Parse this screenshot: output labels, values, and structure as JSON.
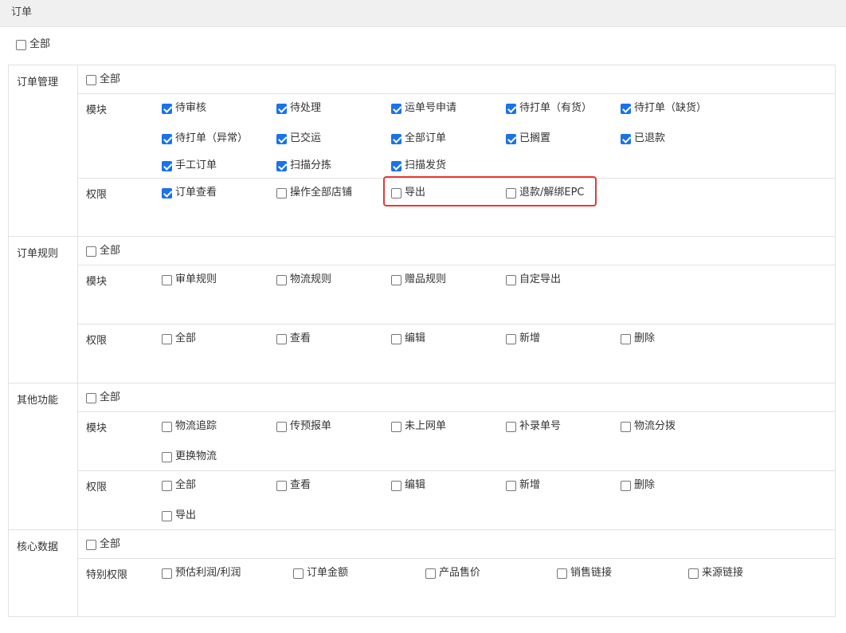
{
  "header": {
    "title": "订单"
  },
  "top_all": {
    "label": "全部",
    "checked": false
  },
  "sections": {
    "order_mgmt": {
      "title": "订单管理",
      "all": {
        "label": "全部",
        "checked": false
      },
      "module_label": "模块",
      "modules": [
        {
          "label": "待审核",
          "checked": true
        },
        {
          "label": "待处理",
          "checked": true
        },
        {
          "label": "运单号申请",
          "checked": true
        },
        {
          "label": "待打单（有货）",
          "checked": true
        },
        {
          "label": "待打单（缺货）",
          "checked": true
        },
        {
          "label": "待打单（异常）",
          "checked": true
        },
        {
          "label": "已交运",
          "checked": true
        },
        {
          "label": "全部订单",
          "checked": true
        },
        {
          "label": "已搁置",
          "checked": true
        },
        {
          "label": "已退款",
          "checked": true
        },
        {
          "label": "手工订单",
          "checked": true
        },
        {
          "label": "扫描分拣",
          "checked": true
        },
        {
          "label": "扫描发货",
          "checked": true
        }
      ],
      "perm_label": "权限",
      "perms": [
        {
          "label": "订单查看",
          "checked": true
        },
        {
          "label": "操作全部店铺",
          "checked": false
        },
        {
          "label": "导出",
          "checked": false
        },
        {
          "label": "退款/解绑EPC",
          "checked": false
        }
      ]
    },
    "order_rules": {
      "title": "订单规则",
      "all": {
        "label": "全部",
        "checked": false
      },
      "module_label": "模块",
      "modules": [
        {
          "label": "审单规则",
          "checked": false
        },
        {
          "label": "物流规则",
          "checked": false
        },
        {
          "label": "赠品规则",
          "checked": false
        },
        {
          "label": "自定导出",
          "checked": false
        }
      ],
      "perm_label": "权限",
      "perms": [
        {
          "label": "全部",
          "checked": false
        },
        {
          "label": "查看",
          "checked": false
        },
        {
          "label": "编辑",
          "checked": false
        },
        {
          "label": "新增",
          "checked": false
        },
        {
          "label": "删除",
          "checked": false
        }
      ]
    },
    "other": {
      "title": "其他功能",
      "all": {
        "label": "全部",
        "checked": false
      },
      "module_label": "模块",
      "modules": [
        {
          "label": "物流追踪",
          "checked": false
        },
        {
          "label": "传预报单",
          "checked": false
        },
        {
          "label": "未上网单",
          "checked": false
        },
        {
          "label": "补录单号",
          "checked": false
        },
        {
          "label": "物流分拨",
          "checked": false
        },
        {
          "label": "更换物流",
          "checked": false
        }
      ],
      "perm_label": "权限",
      "perms": [
        {
          "label": "全部",
          "checked": false
        },
        {
          "label": "查看",
          "checked": false
        },
        {
          "label": "编辑",
          "checked": false
        },
        {
          "label": "新增",
          "checked": false
        },
        {
          "label": "删除",
          "checked": false
        },
        {
          "label": "导出",
          "checked": false
        }
      ]
    },
    "core": {
      "title": "核心数据",
      "all": {
        "label": "全部",
        "checked": false
      },
      "special_label": "特别权限",
      "special": [
        {
          "label": "预估利润/利润",
          "checked": false
        },
        {
          "label": "订单金额",
          "checked": false
        },
        {
          "label": "产品售价",
          "checked": false
        },
        {
          "label": "销售链接",
          "checked": false
        },
        {
          "label": "来源链接",
          "checked": false
        }
      ]
    }
  },
  "colors": {
    "checkbox_checked": "#1a73e8",
    "highlight": "#e53935"
  }
}
